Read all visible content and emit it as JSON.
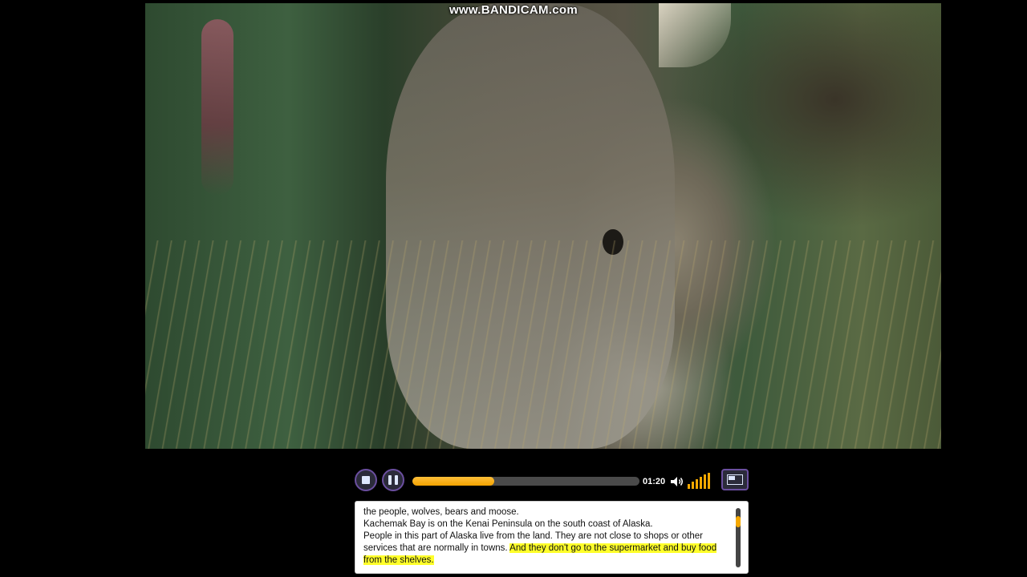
{
  "watermark": "www.BANDICAM.com",
  "player": {
    "time": "01:20",
    "progress_fraction": 0.36,
    "volume_level_bars": 6,
    "volume_total_bars": 6,
    "accent_color": "#f5a800",
    "button_border_color": "#6b4fa0",
    "icons": {
      "stop": "stop-icon",
      "pause": "pause-icon",
      "volume": "speaker-icon",
      "screen": "screen-mode-icon"
    }
  },
  "transcript": {
    "lines": [
      "the people, wolves, bears and moose.",
      "Kachemak Bay is on the Kenai Peninsula on the south coast of Alaska.",
      "People in this part of Alaska live from the land. They are not close to shops or other services that are normally in towns. "
    ],
    "highlighted": "And they don't go to the supermarket and buy food from the shelves.",
    "highlight_color": "#ffff2a"
  }
}
